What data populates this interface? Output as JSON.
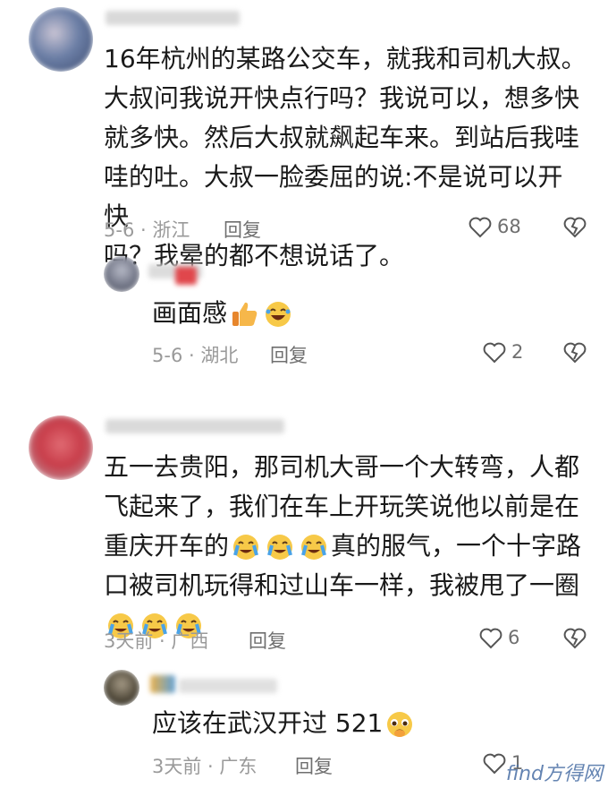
{
  "comments": [
    {
      "text": "16年杭州的某路公交车，就我和司机大叔。大叔问我说开快点行吗？我说可以，想多快就多快。然后大叔就飙起车来。到站后我哇哇的吐。大叔一脸委屈的说:不是说可以开快吗？我晕的都不想说话了。",
      "lines": [
        "16年杭州的某路公交车，就我和司机大叔。",
        "大叔问我说开快点行吗？我说可以，想多快",
        "就多快。然后大叔就飙起车来。到站后我哇",
        "哇的吐。大叔一脸委屈的说:不是说可以开快",
        "吗？我晕的都不想说话了。"
      ],
      "meta": "5-6 · 浙江",
      "reply_label": "回复",
      "likes": "68"
    },
    {
      "text": "画面感",
      "meta": "5-6 · 湖北",
      "reply_label": "回复",
      "likes": "2"
    },
    {
      "lines": [
        "五一去贵阳，那司机大哥一个大转弯，人都",
        "飞起来了，我们在车上开玩笑说他以前是在",
        "重庆开车的",
        "真的服气，一个十字路",
        "口被司机玩得和过山车一样，我被甩了一圈"
      ],
      "meta": "3天前 · 广西",
      "reply_label": "回复",
      "likes": "6"
    },
    {
      "text": "应该在武汉开过 521",
      "meta": "3天前 · 广东",
      "reply_label": "回复",
      "likes": "1"
    }
  ],
  "watermark": "find方得网",
  "icons": [
    "heart-outline-icon",
    "broken-heart-icon",
    "thumbs-up-emoji",
    "laughing-emoji",
    "crying-emoji",
    "pleading-emoji"
  ],
  "colors": {
    "meta": "#9a9a9a",
    "text": "#1a1a1a",
    "reply": "#6f6f6f"
  }
}
